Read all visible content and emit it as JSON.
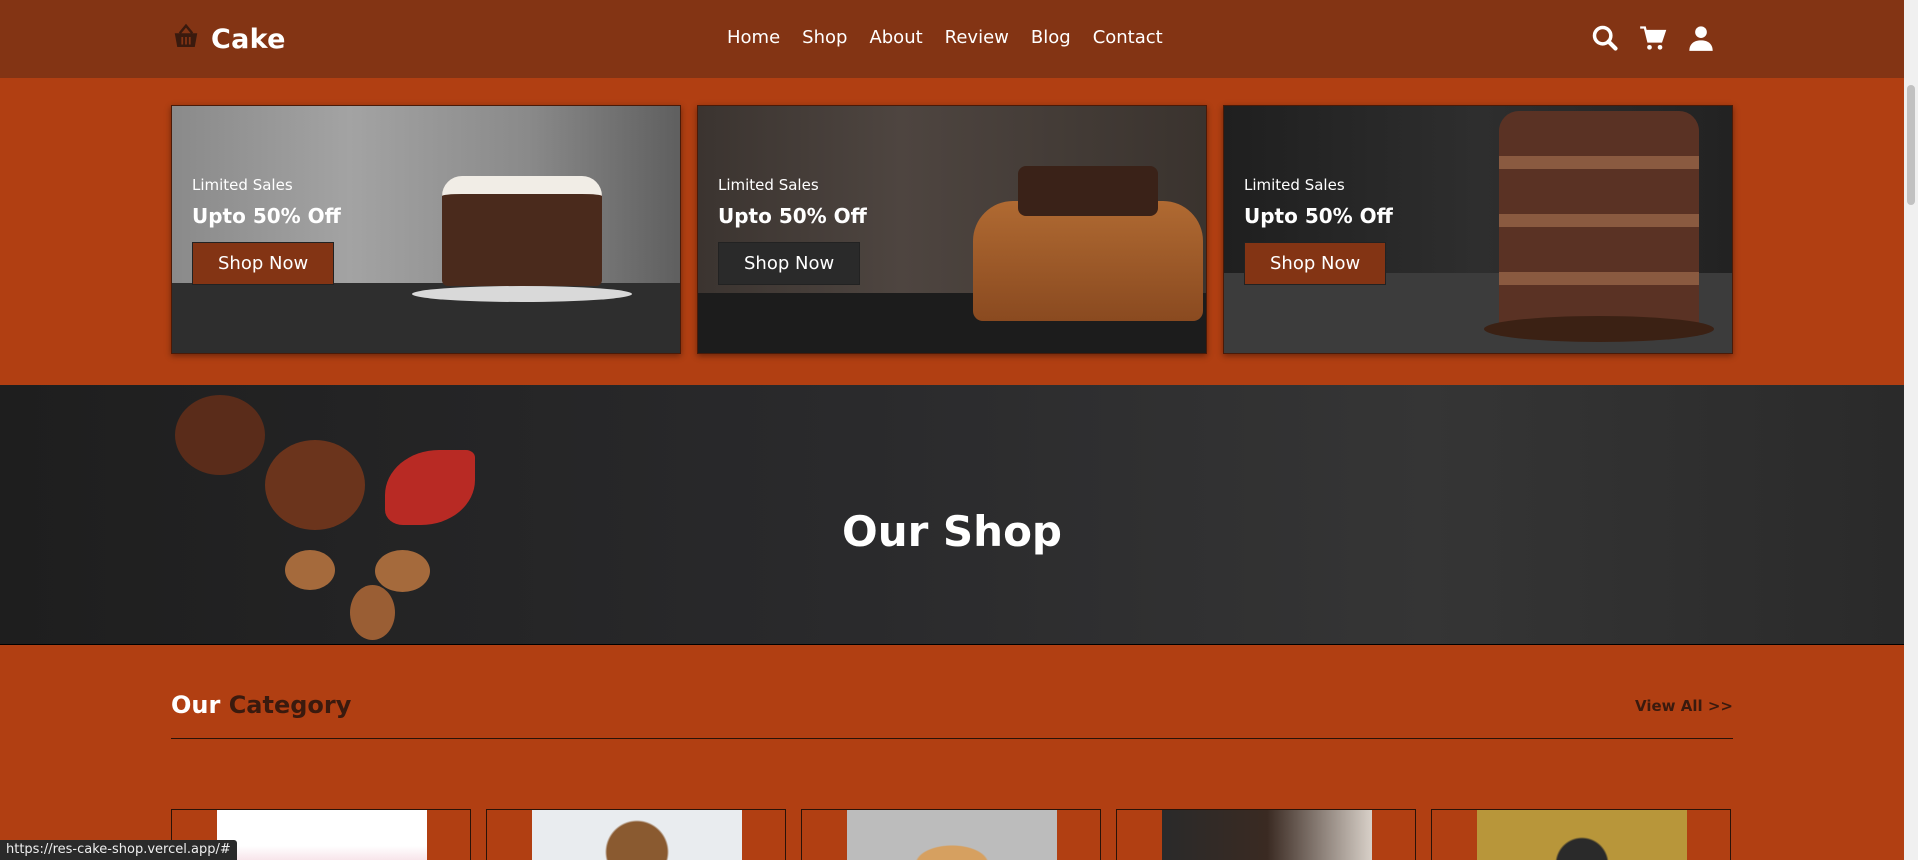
{
  "header": {
    "brand": "Cake",
    "nav": [
      "Home",
      "Shop",
      "About",
      "Review",
      "Blog",
      "Contact"
    ],
    "icons": [
      "search-icon",
      "cart-icon",
      "user-icon"
    ]
  },
  "promos": [
    {
      "label": "Limited Sales",
      "title": "Upto 50% Off",
      "button": "Shop Now",
      "button_style": "brown"
    },
    {
      "label": "Limited Sales",
      "title": "Upto 50% Off",
      "button": "Shop Now",
      "button_style": "dark"
    },
    {
      "label": "Limited Sales",
      "title": "Upto 50% Off",
      "button": "Shop Now",
      "button_style": "brown"
    }
  ],
  "banner": {
    "title": "Our Shop"
  },
  "category": {
    "title_part1": "Our",
    "title_part2": "Category",
    "view_all": "View All >>"
  },
  "status": {
    "url": "https://res-cake-shop.vercel.app/#"
  },
  "colors": {
    "header": "#833414",
    "page": "#b13f12",
    "banner": "#2a2a2c"
  }
}
